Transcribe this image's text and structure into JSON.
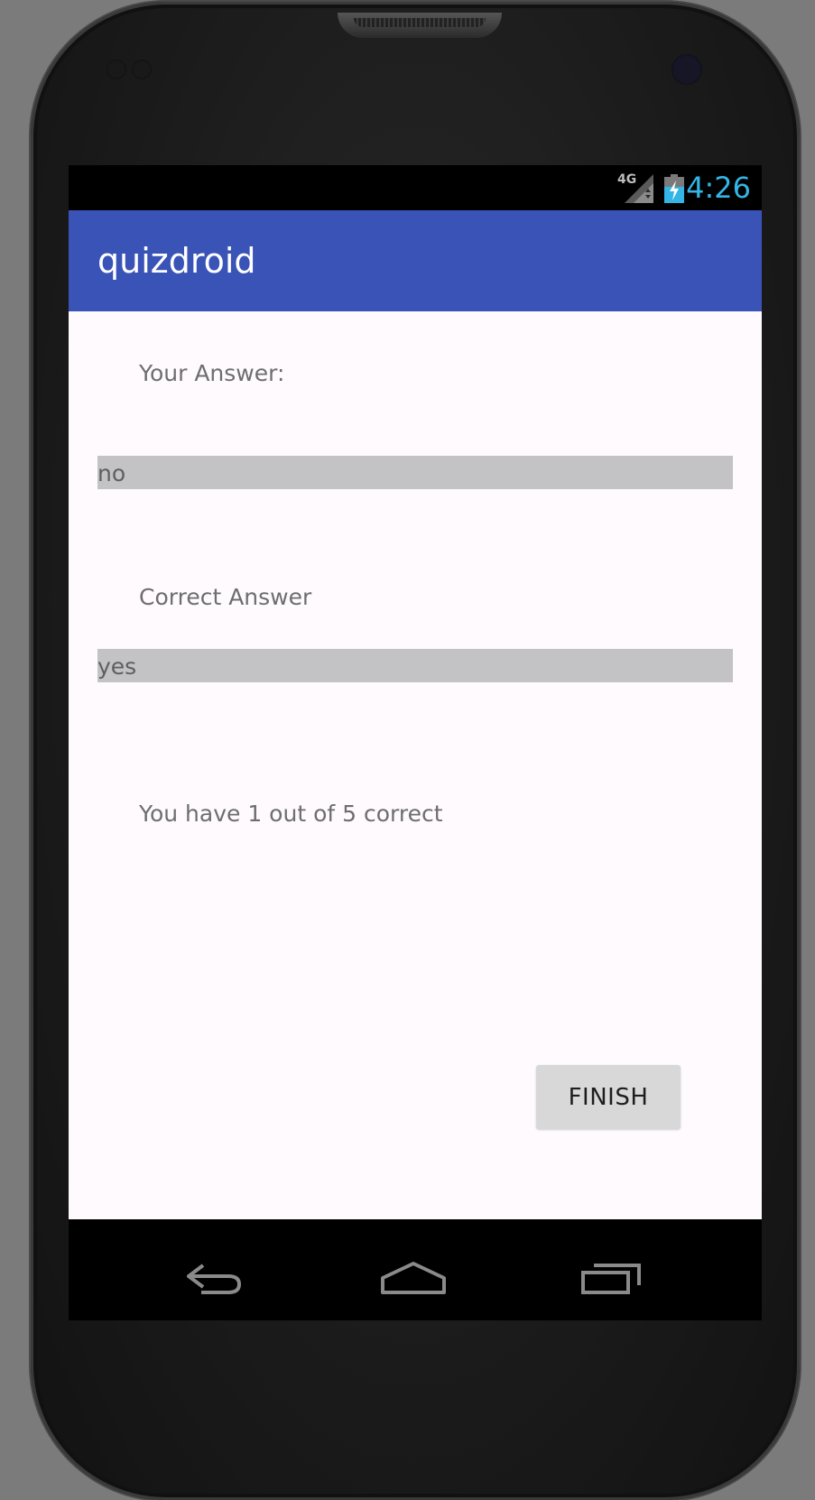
{
  "status_bar": {
    "network": "4G",
    "time": "4:26",
    "clock_color": "#33b5e5"
  },
  "app_bar": {
    "title": "quizdroid",
    "color": "#3a53b7"
  },
  "result": {
    "your_answer_label": "Your Answer:",
    "your_answer_value": "no",
    "correct_answer_label": "Correct Answer",
    "correct_answer_value": "yes",
    "score_text": "You have 1 out of 5 correct"
  },
  "actions": {
    "finish_label": "FINISH"
  },
  "nav_bar": {
    "icons": [
      "back-icon",
      "home-icon",
      "recent-apps-icon"
    ]
  }
}
